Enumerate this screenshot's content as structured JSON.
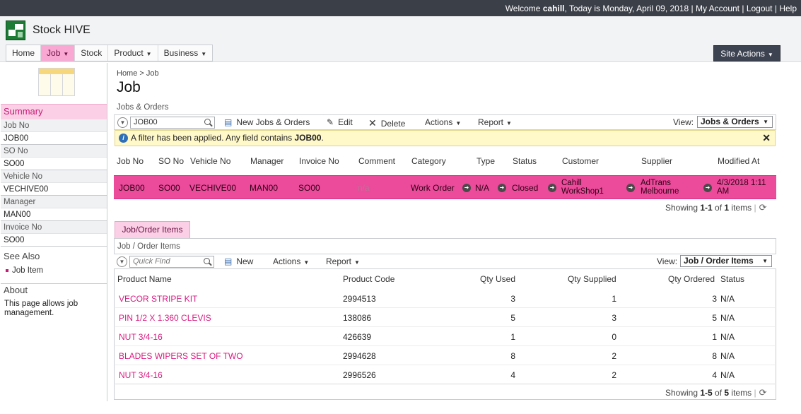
{
  "topbar": {
    "welcome_prefix": "Welcome ",
    "user": "cahill",
    "date_text": ", Today is Monday, April 09, 2018",
    "sep": " | ",
    "my_account": "My Account",
    "logout": "Logout",
    "help": "Help"
  },
  "app": {
    "name": "Stock HIVE"
  },
  "nav": {
    "items": [
      {
        "label": "Home",
        "dropdown": false
      },
      {
        "label": "Job",
        "dropdown": true
      },
      {
        "label": "Stock",
        "dropdown": false
      },
      {
        "label": "Product",
        "dropdown": true
      },
      {
        "label": "Business",
        "dropdown": true
      }
    ],
    "site_actions": "Site Actions"
  },
  "sidebar": {
    "summary_title": "Summary",
    "fields": [
      {
        "label": "Job No",
        "value": "JOB00"
      },
      {
        "label": "SO No",
        "value": "SO00"
      },
      {
        "label": "Vehicle No",
        "value": "VECHIVE00"
      },
      {
        "label": "Manager",
        "value": "MAN00"
      },
      {
        "label": "Invoice No",
        "value": "SO00"
      }
    ],
    "see_also_title": "See Also",
    "see_also_items": [
      "Job Item"
    ],
    "about_title": "About",
    "about_text": "This page allows job management."
  },
  "page": {
    "breadcrumb": {
      "home": "Home",
      "sep": ">",
      "current": "Job"
    },
    "title": "Job"
  },
  "jobs": {
    "section_label": "Jobs & Orders",
    "toolbar": {
      "search_value": "JOB00",
      "new_label": "New Jobs & Orders",
      "edit_label": "Edit",
      "delete_label": "Delete",
      "actions_label": "Actions",
      "report_label": "Report",
      "view_label": "View:",
      "view_value": "Jobs & Orders"
    },
    "filter": {
      "text": "A filter has been applied. Any field contains ",
      "term": "JOB00",
      "end": "."
    },
    "columns": [
      "Job No",
      "SO No",
      "Vehicle No",
      "Manager",
      "Invoice No",
      "Comment",
      "Category",
      "Type",
      "Status",
      "Customer",
      "Supplier",
      "Modified At"
    ],
    "row": {
      "job_no": "JOB00",
      "so_no": "SO00",
      "vehicle_no": "VECHIVE00",
      "manager": "MAN00",
      "invoice_no": "SO00",
      "comment": "n/a",
      "category": "Work Order",
      "type": "N/A",
      "status": "Closed",
      "customer_line1": "Cahill",
      "customer_line2": "WorkShop1",
      "supplier_line1": "AdTrans",
      "supplier_line2": "Melbourne",
      "modified_line1": "4/3/2018 1:11",
      "modified_line2": "AM"
    },
    "showing": {
      "prefix": "Showing ",
      "range": "1-1",
      "of": " of ",
      "total": "1",
      "suffix": " items"
    }
  },
  "items": {
    "tab_label": "Job/Order Items",
    "section_label": "Job / Order Items",
    "toolbar": {
      "search_placeholder": "Quick Find",
      "new_label": "New",
      "actions_label": "Actions",
      "report_label": "Report",
      "view_label": "View:",
      "view_value": "Job / Order Items"
    },
    "columns": [
      "Product Name",
      "Product Code",
      "Qty Used",
      "Qty Supplied",
      "Qty Ordered",
      "Status"
    ],
    "rows": [
      {
        "name": "VECOR STRIPE KIT",
        "code": "2994513",
        "used": "3",
        "supplied": "1",
        "ordered": "3",
        "status": "N/A"
      },
      {
        "name": "PIN 1/2 X 1.360 CLEVIS",
        "code": "138086",
        "used": "5",
        "supplied": "3",
        "ordered": "5",
        "status": "N/A"
      },
      {
        "name": "NUT 3/4-16",
        "code": "426639",
        "used": "1",
        "supplied": "0",
        "ordered": "1",
        "status": "N/A"
      },
      {
        "name": "BLADES WIPERS SET OF TWO",
        "code": "2994628",
        "used": "8",
        "supplied": "2",
        "ordered": "8",
        "status": "N/A"
      },
      {
        "name": "NUT 3/4-16",
        "code": "2996526",
        "used": "4",
        "supplied": "2",
        "ordered": "4",
        "status": "N/A"
      }
    ],
    "showing": {
      "prefix": "Showing ",
      "range": "1-5",
      "of": " of ",
      "total": "5",
      "suffix": " items"
    }
  },
  "colors": {
    "accent": "#ec4a9b",
    "link": "#d81b82",
    "topbar": "#3b3f48"
  }
}
